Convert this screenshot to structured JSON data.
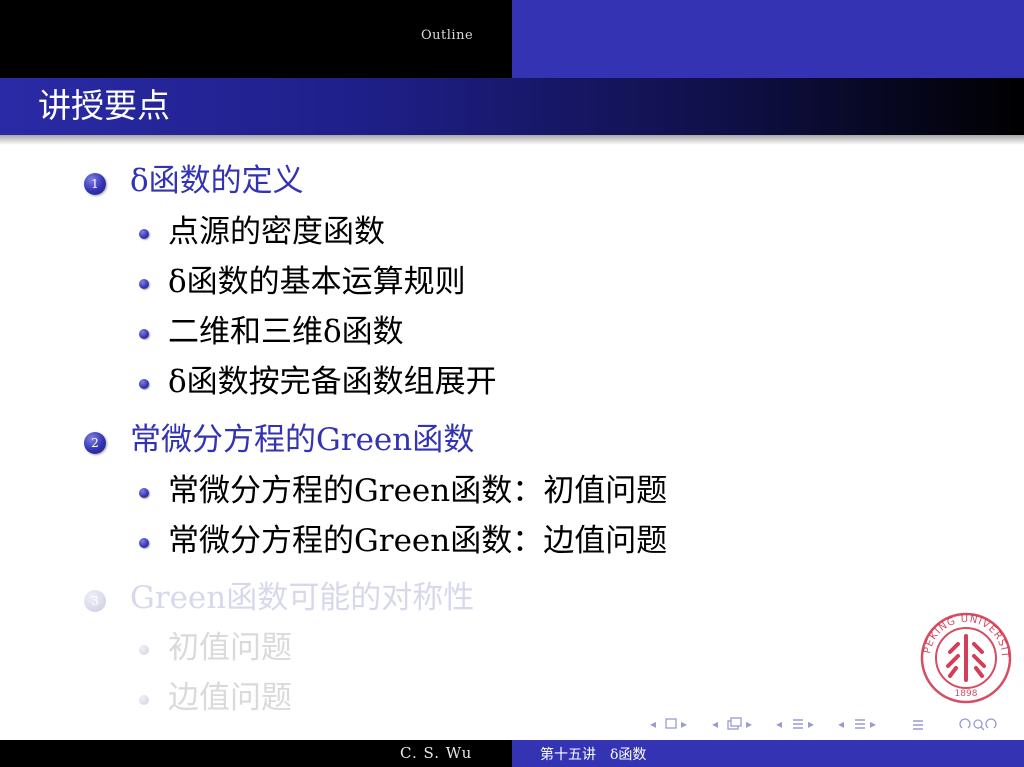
{
  "header": {
    "section_label": "Outline"
  },
  "frame": {
    "title": "讲授要点"
  },
  "sections": [
    {
      "number": "1",
      "title": "δ函数的定义",
      "items": [
        "点源的密度函数",
        "δ函数的基本运算规则",
        "二维和三维δ函数",
        "δ函数按完备函数组展开"
      ]
    },
    {
      "number": "2",
      "title": "常微分方程的Green函数",
      "items": [
        "常微分方程的Green函数：初值问题",
        "常微分方程的Green函数：边值问题"
      ]
    },
    {
      "number": "3",
      "title": "Green函数可能的对称性",
      "items": [
        "初值问题",
        "边值问题"
      ]
    }
  ],
  "emblem": {
    "text": "PEKING UNIVERSITY",
    "year": "1898"
  },
  "footer": {
    "author": "C. S. Wu",
    "lecture": "第十五讲　δ函数"
  },
  "colors": {
    "structure_blue": "#3333b3",
    "black": "#000000",
    "dimmed_text": "#d8d8ec",
    "emblem_red": "#c8102e"
  },
  "navigation": {
    "icons": [
      "nav-left-arrow-icon",
      "frame-icon",
      "nav-right-arrow-icon",
      "subsection-icon",
      "section-icon",
      "align-icon",
      "search-icon"
    ]
  }
}
